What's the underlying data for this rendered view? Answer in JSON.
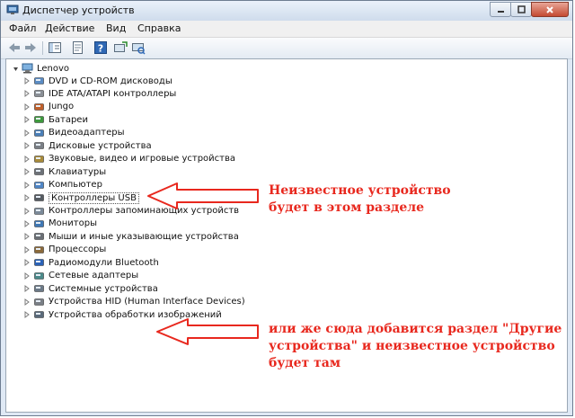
{
  "window": {
    "title": "Диспетчер устройств"
  },
  "menu": [
    {
      "label": "Файл"
    },
    {
      "label": "Действие"
    },
    {
      "label": "Вид"
    },
    {
      "label": "Справка"
    }
  ],
  "tree": {
    "root": "Lenovo",
    "items": [
      {
        "label": "DVD и CD-ROM дисководы",
        "icon": "dvd-drive-icon"
      },
      {
        "label": "IDE ATA/ATAPI контроллеры",
        "icon": "ide-controller-icon"
      },
      {
        "label": "Jungo",
        "icon": "jungo-icon"
      },
      {
        "label": "Батареи",
        "icon": "battery-icon"
      },
      {
        "label": "Видеоадаптеры",
        "icon": "display-adapter-icon"
      },
      {
        "label": "Дисковые устройства",
        "icon": "disk-drive-icon"
      },
      {
        "label": "Звуковые, видео и игровые устройства",
        "icon": "sound-icon"
      },
      {
        "label": "Клавиатуры",
        "icon": "keyboard-icon"
      },
      {
        "label": "Компьютер",
        "icon": "computer-icon"
      },
      {
        "label": "Контроллеры USB",
        "icon": "usb-icon",
        "selected": true
      },
      {
        "label": "Контроллеры запоминающих устройств",
        "icon": "storage-controller-icon"
      },
      {
        "label": "Мониторы",
        "icon": "monitor-icon"
      },
      {
        "label": "Мыши и иные указывающие устройства",
        "icon": "mouse-icon"
      },
      {
        "label": "Процессоры",
        "icon": "processor-icon"
      },
      {
        "label": "Радиомодули Bluetooth",
        "icon": "bluetooth-icon"
      },
      {
        "label": "Сетевые адаптеры",
        "icon": "network-adapter-icon"
      },
      {
        "label": "Системные устройства",
        "icon": "system-device-icon"
      },
      {
        "label": "Устройства HID (Human Interface Devices)",
        "icon": "hid-icon"
      },
      {
        "label": "Устройства обработки изображений",
        "icon": "imaging-device-icon"
      }
    ]
  },
  "annotations": {
    "first": {
      "line1": "Неизвестное устройство",
      "line2": "будет в этом разделе"
    },
    "second": {
      "line1": "или же сюда добавится раздел \"Другие",
      "line2": "устройства\" и неизвестное устройство",
      "line3": "будет там"
    },
    "color": "#e8281e"
  }
}
